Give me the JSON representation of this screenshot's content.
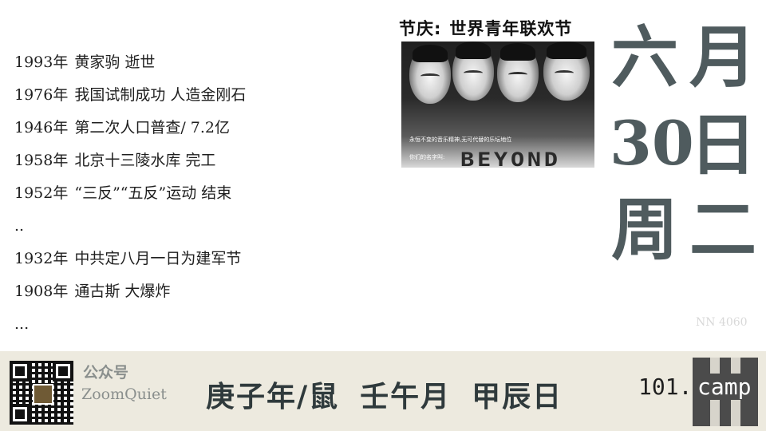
{
  "events": [
    {
      "year": "1993年",
      "text": "黄家驹 逝世"
    },
    {
      "year": "1976年",
      "text": "我国试制成功 人造金刚石"
    },
    {
      "year": "1946年",
      "text": "第二次人口普查/ 7.2亿"
    },
    {
      "year": "1958年",
      "text": "北京十三陵水库 完工"
    },
    {
      "year": "1952年",
      "text": "“三反”“五反”运动 结束"
    },
    {
      "year": "",
      "text": ".."
    },
    {
      "year": "1932年",
      "text": "中共定八月一日为建军节"
    },
    {
      "year": "1908年",
      "text": "通古斯 大爆炸"
    },
    {
      "year": "",
      "text": "..."
    }
  ],
  "festival": {
    "label": "节庆:",
    "name": "世界青年联欢节"
  },
  "photo": {
    "caption": "永恒不变的音乐精神,无可代替的乐坛地位",
    "logo_name": "你们的名字叫:",
    "logo": "BEYOND"
  },
  "date": {
    "month_num": "六",
    "month_label": "月",
    "day_num": "30",
    "day_label": "日",
    "week_label": "周",
    "week_value": "二"
  },
  "watermark": "NN 4060",
  "footer": {
    "account_label": "公众号",
    "account_name": "ZoomQuiet",
    "ganzhi_year": "庚子年/鼠",
    "ganzhi_month": "壬午月",
    "ganzhi_day": "甲辰日",
    "brand_number": "101.",
    "brand_word": "camp"
  },
  "colors": {
    "date_ink": "#4f5b5e",
    "footer_bg": "#edeadf",
    "brand_box": "#4b4b4b"
  }
}
